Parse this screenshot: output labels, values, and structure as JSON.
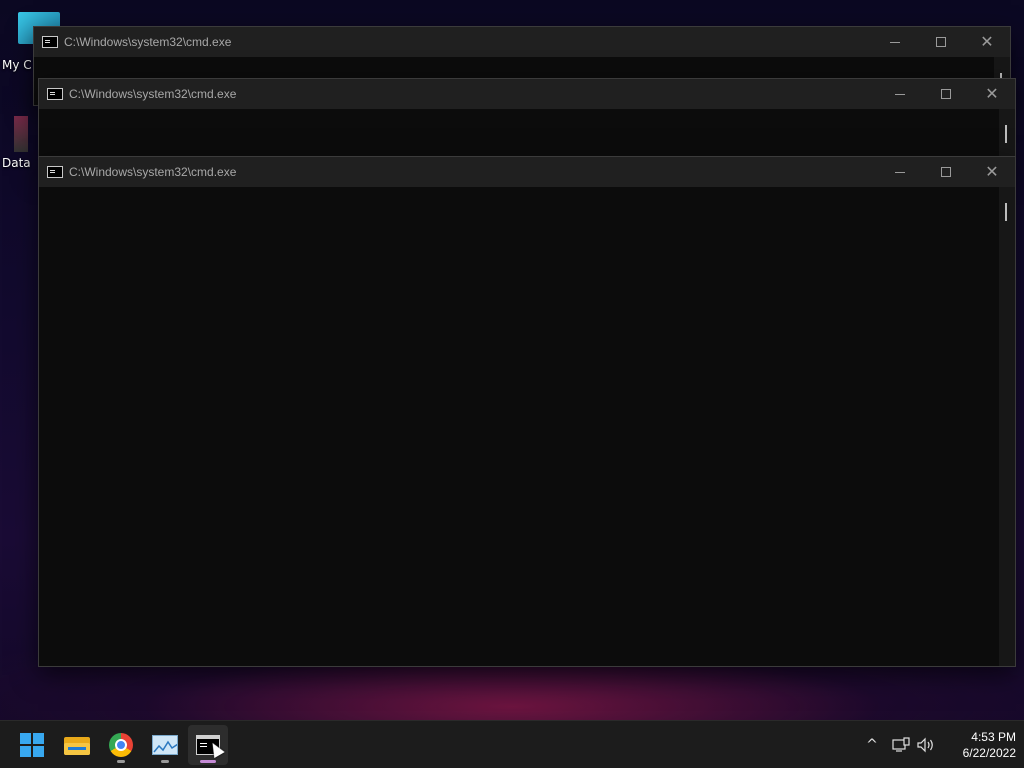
{
  "desktop": {
    "icons": [
      {
        "label": "My C",
        "icon": "computer-icon"
      },
      {
        "label": "Data",
        "icon": "database-icon"
      }
    ]
  },
  "windows": [
    {
      "title": "C:\\Windows\\system32\\cmd.exe",
      "controls": [
        "minimize",
        "maximize",
        "close"
      ]
    },
    {
      "title": "C:\\Windows\\system32\\cmd.exe",
      "controls": [
        "minimize",
        "maximize",
        "close"
      ]
    },
    {
      "title": "C:\\Windows\\system32\\cmd.exe",
      "controls": [
        "minimize",
        "maximize",
        "close"
      ]
    }
  ],
  "taskbar": {
    "apps": [
      {
        "name": "start",
        "icon": "windows-start-icon"
      },
      {
        "name": "file-explorer",
        "icon": "folder-icon"
      },
      {
        "name": "chrome",
        "icon": "chrome-icon"
      },
      {
        "name": "resource-monitor",
        "icon": "monitor-chart-icon"
      },
      {
        "name": "command-prompt",
        "icon": "cmd-icon",
        "active": true
      }
    ],
    "tray": {
      "chevron": "^",
      "time": "4:53 PM",
      "date": "6/22/2022"
    }
  },
  "colors": {
    "titlebar": "#202020",
    "console_bg": "#0c0c0c",
    "taskbar_bg": "#1c1c1c",
    "accent_start": "#38a8f0"
  }
}
